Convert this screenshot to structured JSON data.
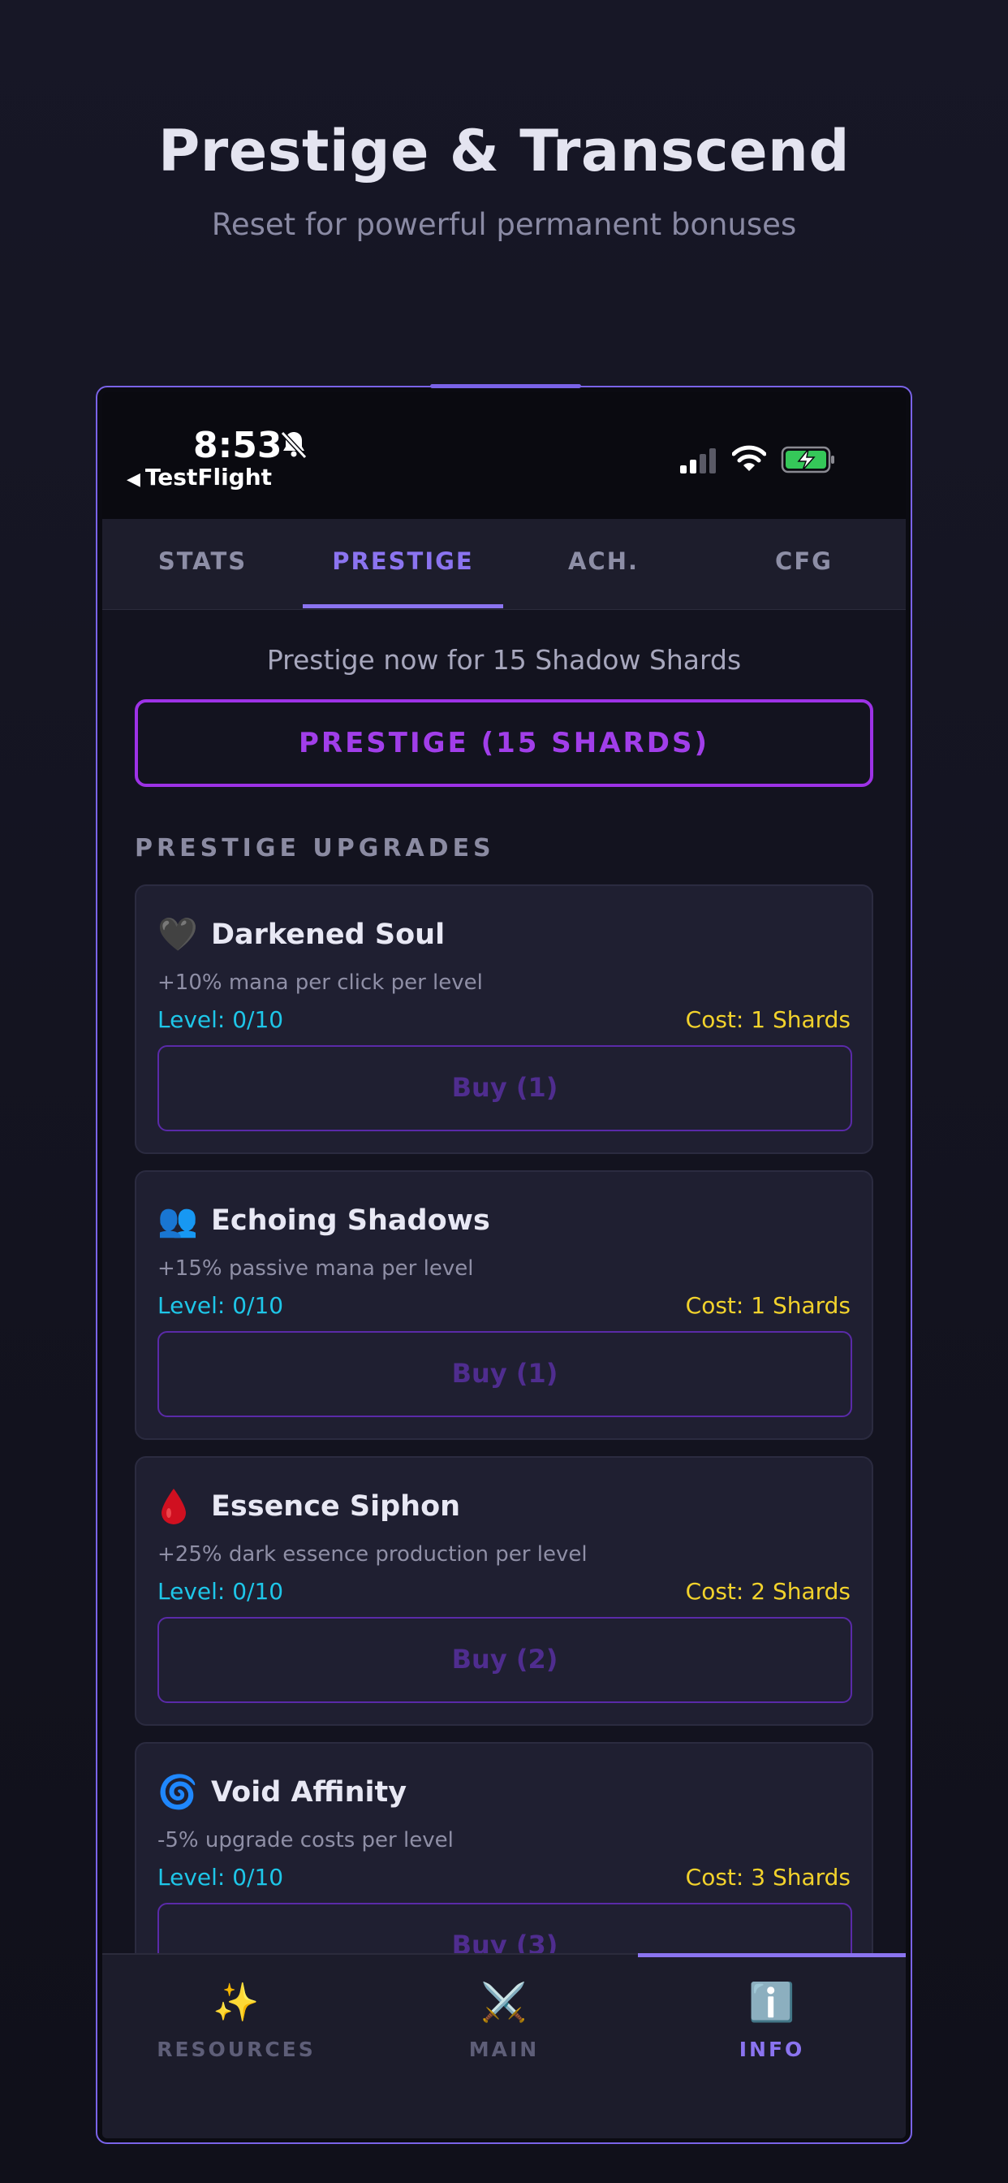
{
  "hero": {
    "title": "Prestige & Transcend",
    "subtitle": "Reset for powerful permanent bonuses"
  },
  "status_bar": {
    "time": "8:53",
    "back_label": "TestFlight",
    "icons": [
      "bell-slash-icon",
      "signal-icon",
      "wifi-icon",
      "battery-charging-icon"
    ]
  },
  "tabs": [
    {
      "label": "STATS",
      "active": false
    },
    {
      "label": "PRESTIGE",
      "active": true
    },
    {
      "label": "ACH.",
      "active": false
    },
    {
      "label": "CFG",
      "active": false
    }
  ],
  "prestige": {
    "info": "Prestige now for 15 Shadow Shards",
    "button_label": "PRESTIGE (15 SHARDS)"
  },
  "upgrades_heading": "PRESTIGE UPGRADES",
  "upgrades": [
    {
      "icon": "🖤",
      "icon_name": "black-heart-icon",
      "name": "Darkened Soul",
      "desc": "+10% mana per click per level",
      "level": "Level: 0/10",
      "cost": "Cost: 1 Shards",
      "buy": "Buy (1)"
    },
    {
      "icon": "👥",
      "icon_name": "busts-icon",
      "name": "Echoing Shadows",
      "desc": "+15% passive mana per level",
      "level": "Level: 0/10",
      "cost": "Cost: 1 Shards",
      "buy": "Buy (1)"
    },
    {
      "icon": "🩸",
      "icon_name": "blood-drop-icon",
      "name": "Essence Siphon",
      "desc": "+25% dark essence production per level",
      "level": "Level: 0/10",
      "cost": "Cost: 2 Shards",
      "buy": "Buy (2)"
    },
    {
      "icon": "🌀",
      "icon_name": "cyclone-icon",
      "name": "Void Affinity",
      "desc": "-5% upgrade costs per level",
      "level": "Level: 0/10",
      "cost": "Cost: 3 Shards",
      "buy": "Buy (3)"
    }
  ],
  "bottom_nav": [
    {
      "icon": "✨",
      "icon_name": "sparkles-icon",
      "label": "RESOURCES",
      "active": false
    },
    {
      "icon": "⚔️",
      "icon_name": "crossed-swords-icon",
      "label": "MAIN",
      "active": false
    },
    {
      "icon": "ℹ️",
      "icon_name": "info-icon",
      "label": "INFO",
      "active": true
    }
  ],
  "colors": {
    "accent": "#8b74f0",
    "prestige": "#a13ee9",
    "level": "#1ec6e8",
    "cost": "#f2d22c"
  }
}
